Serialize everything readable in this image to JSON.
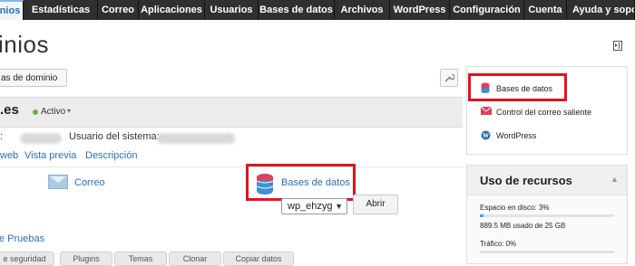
{
  "nav": {
    "tabs": [
      {
        "label": "inios"
      },
      {
        "label": "Estadísticas"
      },
      {
        "label": "Correo"
      },
      {
        "label": "Aplicaciones"
      },
      {
        "label": "Usuarios"
      },
      {
        "label": "Bases de datos"
      },
      {
        "label": "Archivos"
      },
      {
        "label": "WordPress"
      },
      {
        "label": "Configuración"
      },
      {
        "label": "Cuenta"
      },
      {
        "label": "Ayuda y sopo"
      }
    ]
  },
  "page": {
    "title": "inios"
  },
  "toolbar": {
    "domain_button": "as de dominio"
  },
  "domain": {
    "name": ".es",
    "status": "Activo",
    "label_prefix": ":",
    "system_user_label": "Usuario del sistema:",
    "links": [
      {
        "label": "web"
      },
      {
        "label": "Vista previa"
      },
      {
        "label": "Descripción"
      }
    ]
  },
  "services": {
    "correo": "Correo",
    "bases_de_datos": "Bases de datos",
    "db_select_value": "wp_ehzyg",
    "open_button": "Abrir"
  },
  "pruebas": {
    "label": "e Pruebas"
  },
  "bottom_tabs": [
    {
      "label": "e seguridad"
    },
    {
      "label": "Plugins"
    },
    {
      "label": "Temas"
    },
    {
      "label": "Clonar"
    },
    {
      "label": "Copiar datos"
    }
  ],
  "sidebar": {
    "items": [
      {
        "label": "Bases de datos",
        "icon": "database-icon"
      },
      {
        "label": "Control del correo saliente",
        "icon": "mail-icon"
      },
      {
        "label": "WordPress",
        "icon": "wordpress-icon"
      }
    ],
    "resources": {
      "title": "Uso de recursos",
      "disk_label": "Espacio en disco: 3%",
      "disk_fraction": 0.03,
      "disk_detail": "889.5 MB usado de 25 GB",
      "traffic_label": "Tráfico: 0%",
      "traffic_fraction": 0.0
    }
  },
  "colors": {
    "accent": "#2a6eb7",
    "highlight": "#e0141c",
    "nav_bg": "#2b2b2b"
  }
}
